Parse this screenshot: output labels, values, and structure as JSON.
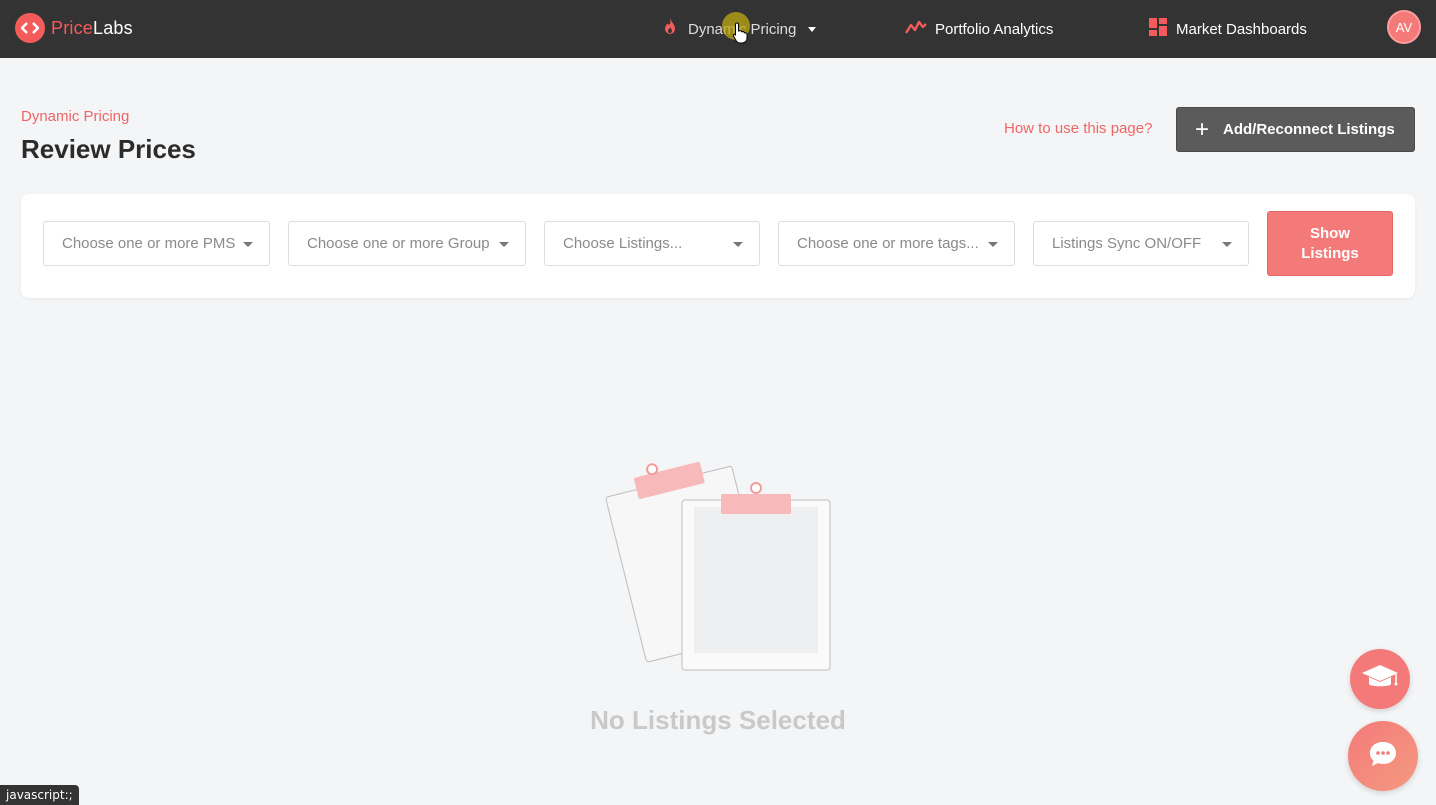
{
  "brand": {
    "part1": "Price",
    "part2": "Labs"
  },
  "nav": {
    "dynamic_pricing": "Dynamic Pricing",
    "portfolio_analytics": "Portfolio Analytics",
    "market_dashboards": "Market Dashboards",
    "avatar_initials": "AV"
  },
  "header": {
    "breadcrumb": "Dynamic Pricing",
    "title": "Review Prices",
    "help_link": "How to use this page?",
    "add_button": "Add/Reconnect Listings"
  },
  "filters": {
    "pms_placeholder": "Choose one or more PMS",
    "group_placeholder": "Choose one or more Group",
    "listings_placeholder": "Choose Listings...",
    "tags_placeholder": "Choose one or more tags...",
    "sync_placeholder": "Listings Sync ON/OFF",
    "show_button_line1": "Show",
    "show_button_line2": "Listings"
  },
  "empty_state": {
    "message": "No Listings Selected"
  },
  "status_bar": {
    "text": "javascript:;"
  },
  "colors": {
    "accent": "#f47a7a",
    "topbar": "#333333",
    "brand_red": "#f45b5b"
  }
}
